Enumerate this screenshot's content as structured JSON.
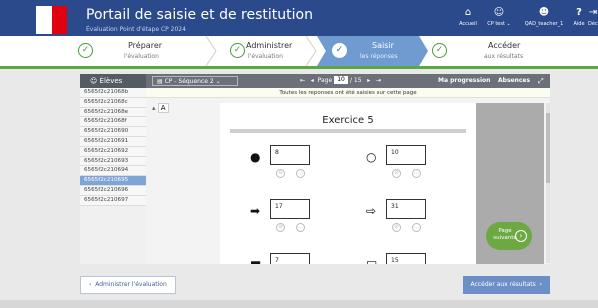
{
  "header": {
    "title": "Portail de saisie et de restitution",
    "subtitle": "Évaluation Point d'étape CP 2024",
    "nav": [
      {
        "label": "Accueil",
        "icon": "home-icon"
      },
      {
        "label": "CP test ⌄",
        "icon": "group-icon"
      },
      {
        "label": "QAD_teacher_1",
        "icon": "user-icon"
      },
      {
        "label": "Aide",
        "icon": "help-icon"
      },
      {
        "label": "Déconnexion",
        "icon": "logout-icon"
      }
    ]
  },
  "steps": [
    {
      "title": "Préparer",
      "sub": "l'évaluation"
    },
    {
      "title": "Administrer",
      "sub": "l'évaluation"
    },
    {
      "title": "Saisir",
      "sub": "les réponses"
    },
    {
      "title": "Accéder",
      "sub": "aux résultats"
    }
  ],
  "toolbar": {
    "students_label": "Élèves",
    "sequence": "CP - Séquence 2",
    "page_label": "Page",
    "page_current": "10",
    "page_total": "/ 15",
    "progress_label": "Ma progression",
    "absences_label": "Absences"
  },
  "students": [
    "6565f2c21068b",
    "6565f2c21068c",
    "6565f2c21068e",
    "6565f2c21068f",
    "6565f2c210690",
    "6565f2c210691",
    "6565f2c210692",
    "6565f2c210693",
    "6565f2c210694",
    "6565f2c210695",
    "6565f2c210696",
    "6565f2c210697"
  ],
  "selected_student_index": 9,
  "notice": "Toutes les reponses ont été saisies sur cette page",
  "exercise": {
    "font_size_label": "A",
    "title": "Exercice 5",
    "items": [
      {
        "shape": "●",
        "value": "8"
      },
      {
        "shape": "○",
        "value": "10"
      },
      {
        "shape": "➡",
        "value": "17"
      },
      {
        "shape": "⇨",
        "value": "31"
      },
      {
        "shape": "■",
        "value": "7"
      },
      {
        "shape": "□",
        "value": "15"
      }
    ]
  },
  "next_page": {
    "line1": "Page",
    "line2": "suivante"
  },
  "footer": {
    "back": "Administrer l'évaluation",
    "forward": "Accéder aux résultats"
  },
  "colors": {
    "header": "#2b4a8c",
    "accent_green": "#5ba842",
    "active_step": "#6f9bd1"
  }
}
